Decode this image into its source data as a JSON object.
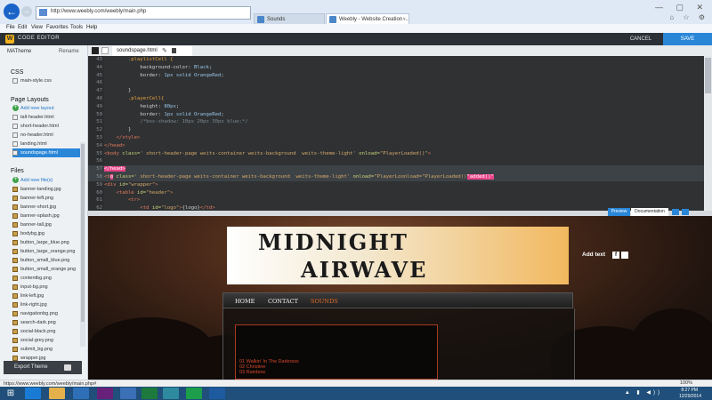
{
  "browser": {
    "address": "http://www.weebly.com/weebly/main.php",
    "tabs": [
      {
        "label": "Sounds"
      },
      {
        "label": "Weebly - Website Creation ..."
      }
    ],
    "window_controls": "— ▢ ✕",
    "menu": [
      "File",
      "Edit",
      "View",
      "Favorites",
      "Tools",
      "Help"
    ]
  },
  "editor": {
    "title": "CODE EDITOR",
    "cancel": "CANCEL",
    "save": "SAVE",
    "file_tab": "soundspage.html",
    "preview_tab": "Preview",
    "documentation_tab": "Documentation"
  },
  "sidebar": {
    "theme_name": "MATheme",
    "rename": "Rename",
    "css_heading": "CSS",
    "css_files": [
      "main-style.css"
    ],
    "layouts_heading": "Page Layouts",
    "add_layout": "Add new layout",
    "layouts": [
      "tall-header.html",
      "short-header.html",
      "no-header.html",
      "landing.html",
      "soundspage.html"
    ],
    "files_heading": "Files",
    "add_files": "Add new file(s)",
    "files": [
      "banner-landing.jpg",
      "banner-left.png",
      "banner-short.jpg",
      "banner-splash.jpg",
      "banner-tall.jpg",
      "bodybg.jpg",
      "button_large_blue.png",
      "button_large_orange.png",
      "button_small_blue.png",
      "button_small_orange.png",
      "contentbg.png",
      "input-bg.png",
      "link-left.jpg",
      "link-right.jpg",
      "navigationbg.png",
      "search-dark.png",
      "social-black.png",
      "social-grey.png",
      "submit_bg.png",
      "wrapper.jpg"
    ],
    "export": "Export Theme"
  },
  "code_lines": [
    {
      "n": "43",
      "parts": [
        [
          "sel",
          "        .playlistCell {"
        ]
      ]
    },
    {
      "n": "44",
      "parts": [
        [
          "prop",
          "            background-color: "
        ],
        [
          "val",
          "Black"
        ],
        [
          "prop",
          ";"
        ]
      ]
    },
    {
      "n": "45",
      "parts": [
        [
          "prop",
          "            border: "
        ],
        [
          "val",
          "1px solid OrangeRed"
        ],
        [
          "prop",
          ";"
        ]
      ]
    },
    {
      "n": "46",
      "parts": [
        [
          "prop",
          ""
        ]
      ]
    },
    {
      "n": "47",
      "parts": [
        [
          "prop",
          "        }"
        ]
      ]
    },
    {
      "n": "48",
      "parts": [
        [
          "sel",
          "        .playerCell{"
        ]
      ]
    },
    {
      "n": "49",
      "parts": [
        [
          "prop",
          "            height: "
        ],
        [
          "val",
          "80px"
        ],
        [
          "prop",
          ";"
        ]
      ]
    },
    {
      "n": "50",
      "parts": [
        [
          "prop",
          "            border: "
        ],
        [
          "val",
          "1px solid OrangeRed"
        ],
        [
          "prop",
          ";"
        ]
      ]
    },
    {
      "n": "51",
      "parts": [
        [
          "cm",
          "            /*box-shadow: 10px 20px 30px blue;*/"
        ]
      ]
    },
    {
      "n": "52",
      "parts": [
        [
          "prop",
          "        }"
        ]
      ]
    },
    {
      "n": "53",
      "parts": [
        [
          "tag",
          "    </style>"
        ]
      ]
    },
    {
      "n": "54",
      "parts": [
        [
          "tag",
          "</head>"
        ]
      ]
    },
    {
      "n": "55",
      "parts": [
        [
          "tag",
          "<body "
        ],
        [
          "attr",
          "class="
        ],
        [
          "str",
          "' short-header-page weits-container weits-background  weits-theme-light'"
        ],
        [
          "attr",
          " onload="
        ],
        [
          "str",
          "\"PlayerLoaded()\""
        ],
        [
          "tag",
          ">"
        ]
      ]
    },
    {
      "n": "56",
      "parts": [
        [
          "prop",
          ""
        ]
      ]
    },
    {
      "n": "57",
      "parts": [
        [
          "mark",
          "</head>"
        ]
      ],
      "hl": true
    },
    {
      "n": "58",
      "parts": [
        [
          "tag",
          "<b"
        ],
        [
          "mark",
          "o"
        ],
        [
          "attr",
          " class="
        ],
        [
          "str",
          "' short-header-page weits-container weits-background  weits-theme-light'"
        ],
        [
          "attr",
          " onload="
        ],
        [
          "str",
          "\"PlayerLoonload=\"PlayerLoaded()"
        ],
        [
          "mark",
          "\"added()\""
        ]
      ],
      "hl": true
    },
    {
      "n": "59",
      "parts": [
        [
          "tag",
          "<div "
        ],
        [
          "attr",
          "id="
        ],
        [
          "str",
          "\"wrapper\""
        ],
        [
          "tag",
          ">"
        ]
      ]
    },
    {
      "n": "60",
      "parts": [
        [
          "tag",
          "    <table "
        ],
        [
          "attr",
          "id="
        ],
        [
          "str",
          "\"header\""
        ],
        [
          "tag",
          ">"
        ]
      ]
    },
    {
      "n": "61",
      "parts": [
        [
          "tag",
          "        <tr>"
        ]
      ]
    },
    {
      "n": "62",
      "parts": [
        [
          "tag",
          "            <td "
        ],
        [
          "attr",
          "id="
        ],
        [
          "str",
          "\"logo\""
        ],
        [
          "tag",
          ">"
        ],
        [
          "prop",
          "{logo}"
        ],
        [
          "tag",
          "</td>"
        ]
      ]
    },
    {
      "n": "63",
      "parts": [
        [
          "tag",
          "            <td "
        ],
        [
          "attr",
          "id="
        ],
        [
          "str",
          "\"header-right\""
        ],
        [
          "tag",
          ">"
        ]
      ]
    }
  ],
  "preview": {
    "banner_line1": "MIDNIGHT",
    "banner_line2": "AIRWAVE",
    "add_text": "Add text",
    "nav": [
      "HOME",
      "CONTACT",
      "SOUNDS"
    ],
    "nav_active_color": "#e36a2a",
    "tracks": [
      "01  Walkin' In The Darkness",
      "02  Christine",
      "03  Rainbow"
    ]
  },
  "status": {
    "url": "https://www.weebly.com/weebly/main.php#",
    "zoom": "100%"
  },
  "taskbar": {
    "time": "8:27 PM",
    "date": "12/29/2014"
  },
  "colors": {
    "accent": "#2a87d8",
    "editor_bg": "#2f3133",
    "highlight": "#e94589"
  }
}
